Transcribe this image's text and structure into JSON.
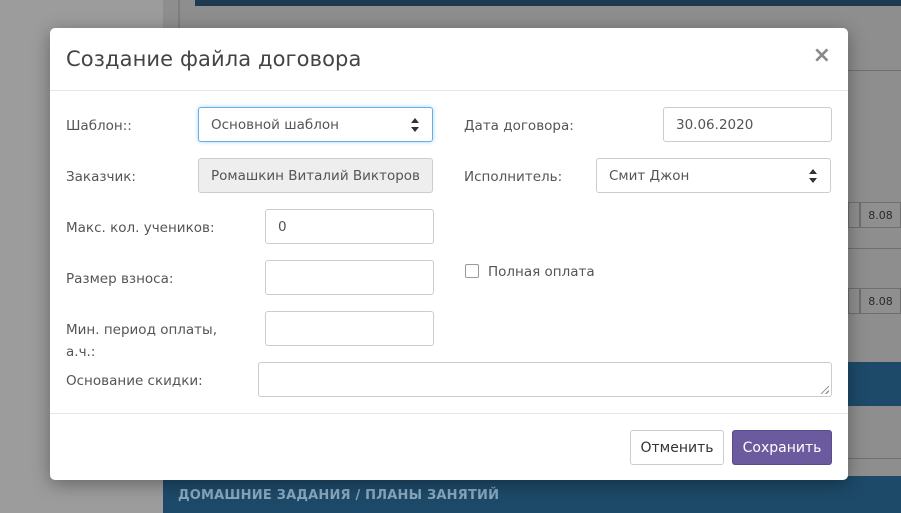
{
  "background": {
    "cells_row1": [
      "8.08"
    ],
    "cells_row2": [
      "8.08"
    ],
    "section_title": "ДОМАШНИЕ ЗАДАНИЯ / ПЛАНЫ ЗАНЯТИЙ"
  },
  "modal": {
    "title": "Создание файла договора",
    "close_symbol": "×",
    "template": {
      "label": "Шаблон::",
      "value": "Основной шаблон"
    },
    "contract_date": {
      "label": "Дата договора:",
      "value": "30.06.2020"
    },
    "customer": {
      "label": "Заказчик:",
      "value": "Ромашкин Виталий Викторович"
    },
    "executor": {
      "label": "Исполнитель:",
      "value": "Смит Джон"
    },
    "max_students": {
      "label": "Макс. кол. учеников:",
      "value": "0"
    },
    "fee_size": {
      "label": "Размер взноса:",
      "value": ""
    },
    "full_payment": {
      "label": "Полная оплата",
      "checked": false
    },
    "min_period": {
      "label_line1": "Мин. период оплаты,",
      "label_line2": "а.ч.:",
      "value": ""
    },
    "discount_reason": {
      "label": "Основание скидки:",
      "value": ""
    },
    "cancel_label": "Отменить",
    "save_label": "Сохранить"
  },
  "colors": {
    "primary_button": "#6b5b9e",
    "focus_border": "#66afe9",
    "bg_section": "#1d4a69"
  }
}
